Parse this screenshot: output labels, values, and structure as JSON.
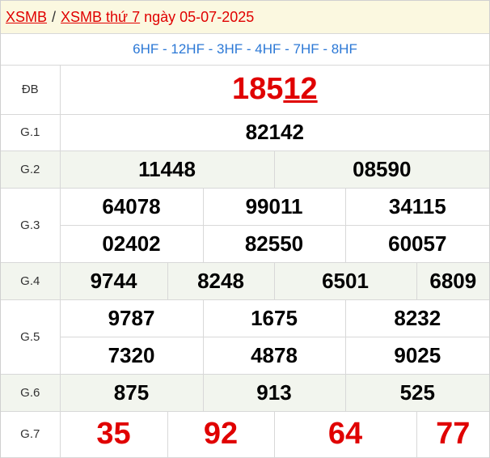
{
  "header": {
    "link1": "XSMB",
    "separator": "/",
    "link2": "XSMB thứ 7",
    "date_text": "ngày 05-07-2025"
  },
  "codes": "6HF - 12HF - 3HF - 4HF - 7HF - 8HF",
  "prizes": {
    "db": {
      "label": "ĐB",
      "prefix": "185",
      "suffix": "12"
    },
    "g1": {
      "label": "G.1",
      "values": [
        "82142"
      ]
    },
    "g2": {
      "label": "G.2",
      "values": [
        "11448",
        "08590"
      ]
    },
    "g3": {
      "label": "G.3",
      "values": [
        "64078",
        "99011",
        "34115",
        "02402",
        "82550",
        "60057"
      ]
    },
    "g4": {
      "label": "G.4",
      "values": [
        "9744",
        "8248",
        "6501",
        "6809"
      ]
    },
    "g5": {
      "label": "G.5",
      "values": [
        "9787",
        "1675",
        "8232",
        "7320",
        "4878",
        "9025"
      ]
    },
    "g6": {
      "label": "G.6",
      "values": [
        "875",
        "913",
        "525"
      ]
    },
    "g7": {
      "label": "G.7",
      "values": [
        "35",
        "92",
        "64",
        "77"
      ]
    }
  },
  "colors": {
    "red": "#e00000",
    "blue": "#2b78d6",
    "header_bg": "#fbf8e0",
    "alt_row_bg": "#f2f5ee"
  }
}
